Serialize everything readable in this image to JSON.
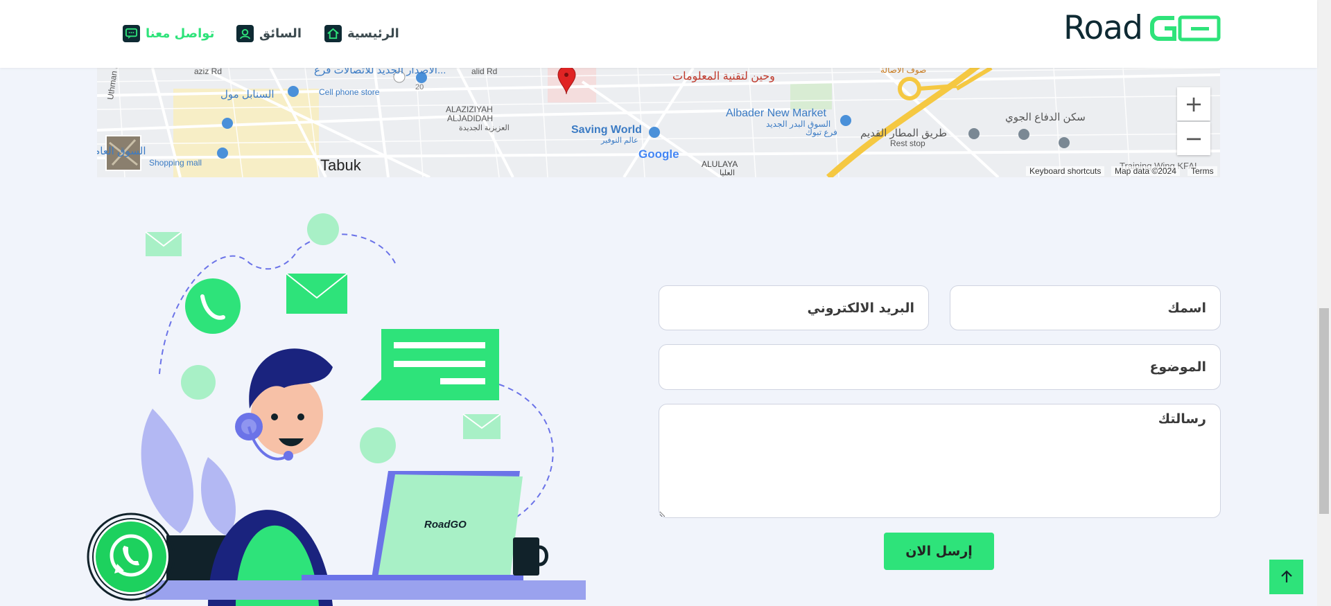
{
  "header": {
    "logo_word": "Road",
    "logo_mark": "GO",
    "nav": [
      {
        "label": "الرئيسية",
        "icon": "home-icon"
      },
      {
        "label": "السائق",
        "icon": "driver-icon"
      },
      {
        "label": "تواصل معنا",
        "icon": "chat-icon"
      }
    ]
  },
  "map": {
    "places": [
      {
        "label": "وحين لتقنية المعلومات"
      },
      {
        "label": "الاصدار الجديد للاتصالات فرع..."
      },
      {
        "label": "Cell phone store"
      },
      {
        "label": "السنابل مول"
      },
      {
        "label": "السوق العام"
      },
      {
        "label": "Shopping mall"
      },
      {
        "label": "Tabuk"
      },
      {
        "label": "ALAZIZIYAH"
      },
      {
        "label": "ALJADIDAH"
      },
      {
        "label": "العزيزية الجديدة"
      },
      {
        "label": "Saving World"
      },
      {
        "label": "عالم التوفير"
      },
      {
        "label": "Albader New Market"
      },
      {
        "label": "السوق البدر الجديد"
      },
      {
        "label": "فرع تبوك"
      },
      {
        "label": "طريق المطار القديم"
      },
      {
        "label": "Rest stop"
      },
      {
        "label": "سكن الدفاع الجوي"
      },
      {
        "label": "ALULAYA"
      },
      {
        "label": "العليا"
      },
      {
        "label": "Uthman Ibn A"
      },
      {
        "label": "aziz Rd"
      },
      {
        "label": "alid Rd"
      },
      {
        "label": "صوف الأصالة"
      },
      {
        "label": "Training Wing KFAI"
      },
      {
        "label": "20"
      }
    ],
    "google_label": "Google",
    "zoom_in": "+",
    "zoom_out": "−",
    "attribution": {
      "shortcuts": "Keyboard shortcuts",
      "data": "Map data ©2024",
      "terms": "Terms"
    }
  },
  "form": {
    "name_placeholder": "اسمك",
    "email_placeholder": "البريد الالكتروني",
    "subject_placeholder": "الموضوع",
    "message_placeholder": "رسالتك",
    "submit_label": "إرسل الان"
  },
  "illustration": {
    "laptop_brand": "RoadGO"
  },
  "colors": {
    "accent": "#2ee37a",
    "dark": "#0e2a33",
    "background": "#f1f4fb"
  }
}
